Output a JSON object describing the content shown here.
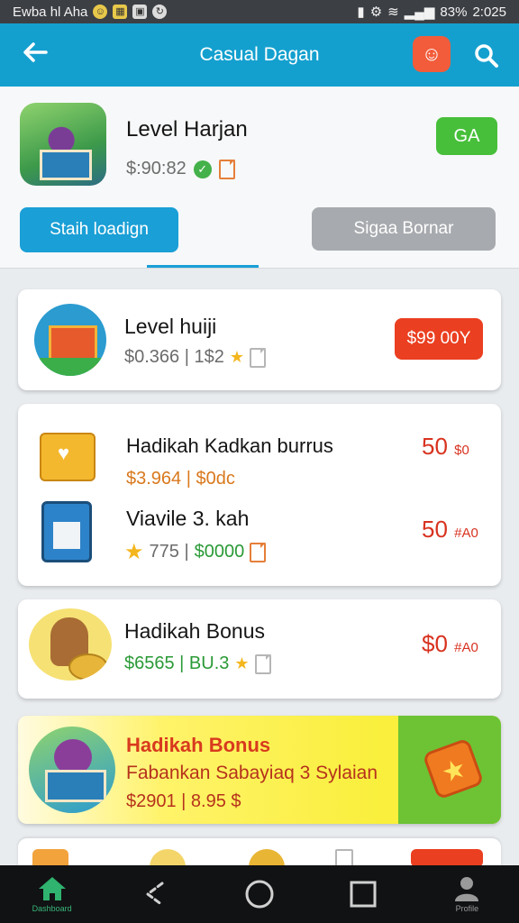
{
  "status_bar": {
    "carrier": "Ewba hl Aha",
    "battery": "83%",
    "time": "2:025"
  },
  "app_bar": {
    "title": "Casual Dagan",
    "brand_icon": "brand-app-icon",
    "search_icon": "search-icon",
    "back_icon": "arrow-left-icon"
  },
  "header": {
    "title": "Level Harjan",
    "price": "$:90:82",
    "action_label": "GA",
    "primary_label": "Staih loadign",
    "secondary_label": "Sigaa Bornar"
  },
  "items": [
    {
      "title": "Level huiji",
      "subtitle": "$0.366 | 1$2",
      "price_label": "$99 00Y"
    },
    {
      "title": "Hadikah Kadkan burrus",
      "subtitle": "$3.964 | $0dc",
      "price": "50",
      "price_suffix": "$0"
    },
    {
      "title": "Viavile 3. kah",
      "subtitle_grey": "775 |",
      "subtitle_green": "$0000",
      "price": "50",
      "price_suffix": "#A0"
    },
    {
      "title": "Hadikah Bonus",
      "subtitle": "$6565 | BU.3",
      "price": "$0",
      "price_suffix": "#A0"
    }
  ],
  "promo": {
    "title": "Hadikah Bonus",
    "subtitle": "Fabankan Sabayiaq 3 Sylaian",
    "price": "$2901 | 8.95 $"
  },
  "nav": {
    "home_caption": "Dashboard",
    "profile_caption": "Profile"
  },
  "colors": {
    "app_bar": "#14a0cf",
    "accent_green": "#47bf3a",
    "accent_red": "#ea3f20",
    "promo_yellow": "#f9ef3c"
  }
}
